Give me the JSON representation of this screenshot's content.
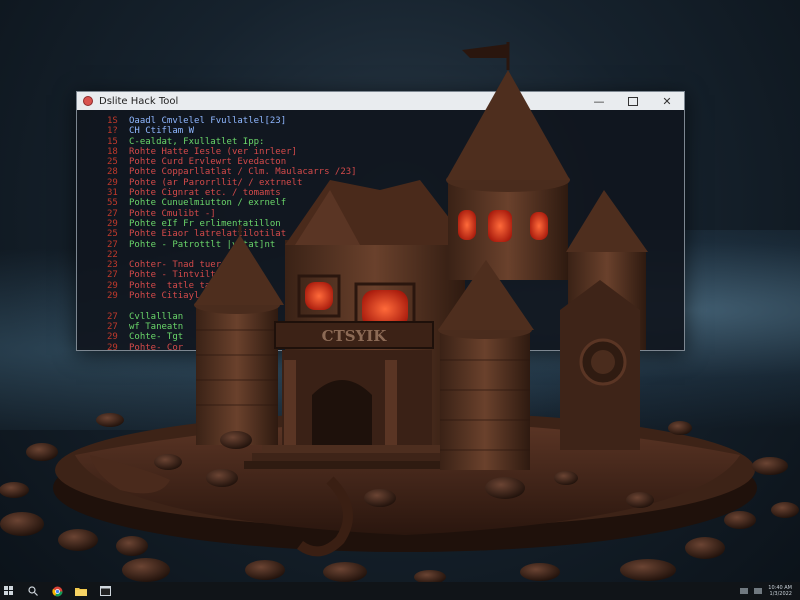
{
  "window": {
    "title": "Dslite Hack Tool",
    "minimize_icon": "minimize-icon",
    "maximize_icon": "maximize-icon",
    "close_icon": "close-icon"
  },
  "code_lines": [
    {
      "num": "1S",
      "text": "Oaadl Cmvlelel Fvullatlel[23]",
      "color": "#8fb7ff"
    },
    {
      "num": "1?",
      "text": "CH Ctiflam W",
      "color": "#8fb7ff"
    },
    {
      "num": "15",
      "text": "C-ealdat, Fxullatlet Ipp:",
      "color": "#6ad66a"
    },
    {
      "num": "18",
      "text": "Rohte Hatte Iesle (ver inrleer]",
      "color": "#d44a4a"
    },
    {
      "num": "25",
      "text": "Pohte Curd Ervlewrt Evedacton",
      "color": "#d44a4a"
    },
    {
      "num": "28",
      "text": "Pohte Copparllatlat / Clm. Maulacarrs /23]",
      "color": "#d44a4a"
    },
    {
      "num": "29",
      "text": "Pohte (ar Parorrllit/ / extrnelt",
      "color": "#d44a4a"
    },
    {
      "num": "31",
      "text": "Pohte Cignrat etc. / tomamts",
      "color": "#d44a4a"
    },
    {
      "num": "55",
      "text": "Pohte Cunuelmiutton / exrnelf",
      "color": "#6ad66a"
    },
    {
      "num": "27",
      "text": "Pohte Cmulibt -]",
      "color": "#d44a4a"
    },
    {
      "num": "29",
      "text": "Pohte eIf Fr erlimentatillon",
      "color": "#6ad66a"
    },
    {
      "num": "25",
      "text": "Pohte Eiaor latrelattilotilat",
      "color": "#d44a4a"
    },
    {
      "num": "27",
      "text": "Pohte - Patrottlt |vytat]nt",
      "color": "#6ad66a"
    },
    {
      "num": "22",
      "text": "",
      "color": "#6ad66a"
    },
    {
      "num": "23",
      "text": "Cohter- Tnad tuer",
      "color": "#d44a4a"
    },
    {
      "num": "27",
      "text": "Pohte - Tintvilt ov",
      "color": "#d44a4a"
    },
    {
      "num": "29",
      "text": "Pohte  tatle tal",
      "color": "#d44a4a"
    },
    {
      "num": "29",
      "text": "Pohte Citiayl",
      "color": "#d44a4a"
    },
    {
      "num": "",
      "text": "",
      "color": "#6ad66a"
    },
    {
      "num": "27",
      "text": "Cvllalllan",
      "color": "#6ad66a"
    },
    {
      "num": "27",
      "text": "wf Taneatn",
      "color": "#6ad66a"
    },
    {
      "num": "29",
      "text": "Cohte- Tgt",
      "color": "#6ad66a"
    },
    {
      "num": "29",
      "text": "Pohte- Cor",
      "color": "#d44a4a"
    }
  ],
  "castle_sign": "CTSYIK",
  "taskbar": {
    "items": [
      "start-icon",
      "search-icon",
      "chrome-icon",
      "file-explorer-icon",
      "app-icon"
    ],
    "clock_time": "10:40 AM",
    "clock_date": "1/3/2022"
  }
}
